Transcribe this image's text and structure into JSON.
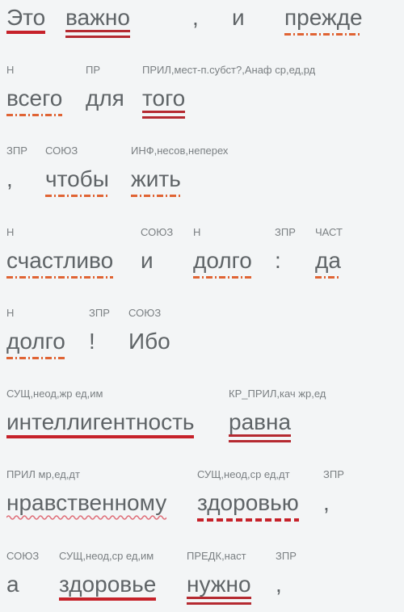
{
  "sentence_parse": {
    "colors": {
      "background": "#f3f5f6",
      "word_text": "#5f6467",
      "tag_text": "#7a7f82",
      "subject_underline": "#c6222a",
      "predicate_underline": "#b52a31",
      "adverbial_underline": "#e06434",
      "object_underline": "#c6222a",
      "attribute_underline": "#e0707a"
    },
    "lines": [
      {
        "words": [
          {
            "text": "Это",
            "underline": "subject"
          },
          {
            "text": "важно",
            "underline": "predicate"
          },
          {
            "text": ",",
            "underline": "none"
          },
          {
            "text": "и",
            "underline": "none"
          },
          {
            "text": "прежде",
            "underline": "adverbial"
          }
        ]
      },
      {
        "tags": [
          "Н",
          "ПР",
          "ПРИЛ,мест-п.субст?,Анаф ср,ед,рд"
        ],
        "words": [
          {
            "text": "всего",
            "underline": "adverbial"
          },
          {
            "text": "для",
            "underline": "none"
          },
          {
            "text": "того",
            "underline": "predicate"
          }
        ]
      },
      {
        "tags": [
          "ЗПР",
          "СОЮЗ",
          "ИНФ,несов,неперех"
        ],
        "words": [
          {
            "text": ",",
            "underline": "none"
          },
          {
            "text": "чтобы",
            "underline": "adverbial"
          },
          {
            "text": "жить",
            "underline": "adverbial"
          }
        ]
      },
      {
        "tags": [
          "Н",
          "СОЮЗ",
          "Н",
          "ЗПР",
          "ЧАСТ"
        ],
        "words": [
          {
            "text": "счастливо",
            "underline": "adverbial"
          },
          {
            "text": "и",
            "underline": "none"
          },
          {
            "text": "долго",
            "underline": "adverbial"
          },
          {
            "text": ":",
            "underline": "none"
          },
          {
            "text": "да",
            "underline": "adverbial"
          }
        ]
      },
      {
        "tags": [
          "Н",
          "ЗПР",
          "СОЮЗ"
        ],
        "words": [
          {
            "text": "долго",
            "underline": "adverbial"
          },
          {
            "text": "!",
            "underline": "none"
          },
          {
            "text": "Ибо",
            "underline": "none"
          }
        ]
      },
      {
        "tags": [
          "СУЩ,неод,жр ед,им",
          "КР_ПРИЛ,кач жр,ед"
        ],
        "words": [
          {
            "text": "интеллигентность",
            "underline": "subject"
          },
          {
            "text": "равна",
            "underline": "predicate"
          }
        ]
      },
      {
        "tags": [
          "ПРИЛ мр,ед,дт",
          "СУЩ,неод,ср ед,дт",
          "ЗПР"
        ],
        "words": [
          {
            "text": "нравственному",
            "underline": "attribute"
          },
          {
            "text": "здоровью",
            "underline": "object"
          },
          {
            "text": ",",
            "underline": "none"
          }
        ]
      },
      {
        "tags": [
          "СОЮЗ",
          "СУЩ,неод,ср ед,им",
          "ПРЕДК,наст",
          "ЗПР"
        ],
        "words": [
          {
            "text": "а",
            "underline": "none"
          },
          {
            "text": "здоровье",
            "underline": "subject"
          },
          {
            "text": "нужно",
            "underline": "predicate"
          },
          {
            "text": ",",
            "underline": "none"
          }
        ]
      }
    ]
  }
}
